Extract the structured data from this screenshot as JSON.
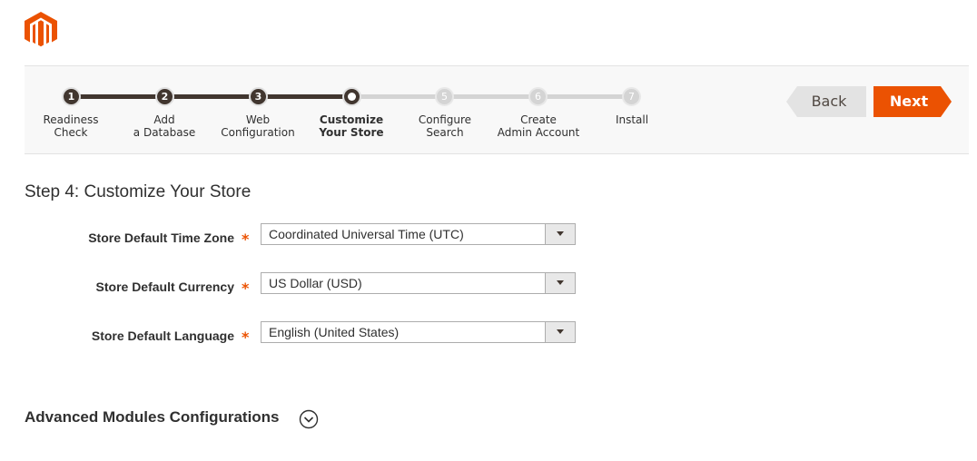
{
  "logo": {
    "icon": "magento-logo",
    "color": "#eb5202"
  },
  "wizard": {
    "steps": [
      {
        "number": "1",
        "label": "Readiness\nCheck",
        "state": "done"
      },
      {
        "number": "2",
        "label": "Add\na Database",
        "state": "done"
      },
      {
        "number": "3",
        "label": "Web\nConfiguration",
        "state": "done"
      },
      {
        "number": "4",
        "label": "Customize\nYour Store",
        "state": "current"
      },
      {
        "number": "5",
        "label": "Configure\nSearch",
        "state": "todo"
      },
      {
        "number": "6",
        "label": "Create\nAdmin Account",
        "state": "todo"
      },
      {
        "number": "7",
        "label": "Install",
        "state": "todo"
      }
    ],
    "back_label": "Back",
    "next_label": "Next",
    "colors": {
      "accent": "#eb5202",
      "done": "#41362f",
      "todo": "#d4d4d4"
    }
  },
  "main": {
    "title": "Step 4: Customize Your Store",
    "fields": [
      {
        "label": "Store Default Time Zone",
        "required_mark": "*",
        "value": "Coordinated Universal Time (UTC)"
      },
      {
        "label": "Store Default Currency",
        "required_mark": "*",
        "value": "US Dollar (USD)"
      },
      {
        "label": "Store Default Language",
        "required_mark": "*",
        "value": "English (United States)"
      }
    ],
    "advanced": {
      "label": "Advanced Modules Configurations",
      "icon": "chevron-down-circle-icon"
    }
  }
}
